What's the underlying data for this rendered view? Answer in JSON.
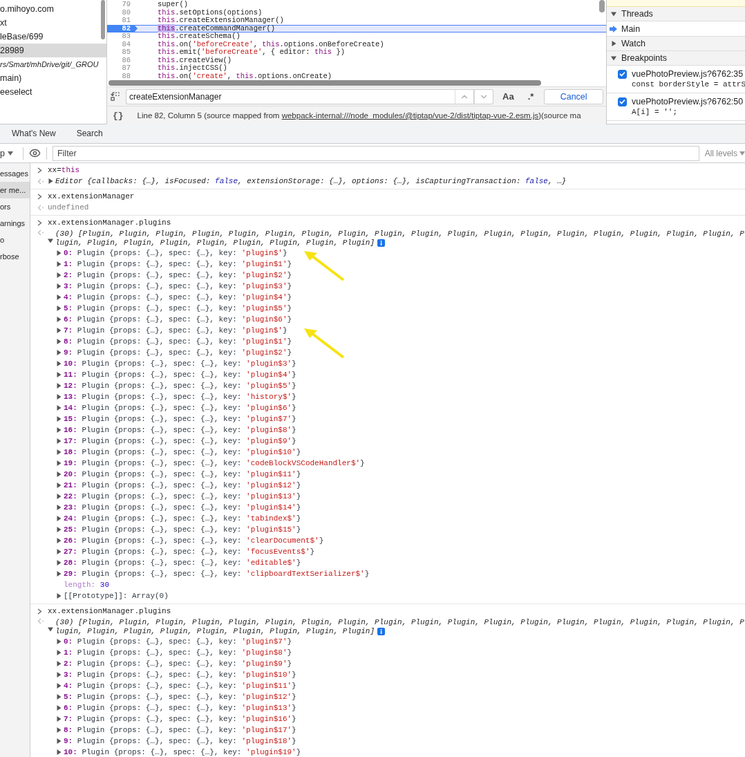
{
  "file_tree": {
    "items": [
      {
        "label": "o.mihoyo.com",
        "selected": false,
        "italic": false
      },
      {
        "label": "xt",
        "selected": false,
        "italic": false
      },
      {
        "label": "leBase/699",
        "selected": false,
        "italic": false
      },
      {
        "label": "28989",
        "selected": true,
        "italic": false
      },
      {
        "label": "rs/Smart/mhDrive/git/_GROU",
        "selected": false,
        "italic": true
      },
      {
        "label": "main)",
        "selected": false,
        "italic": false
      },
      {
        "label": "eeselect",
        "selected": false,
        "italic": false
      }
    ]
  },
  "editor": {
    "lines": [
      {
        "number": "79",
        "current": false,
        "tokens": [
          {
            "kind": "plain",
            "text": "super()"
          }
        ]
      },
      {
        "number": "80",
        "current": false,
        "tokens": [
          {
            "kind": "keyword",
            "text": "this"
          },
          {
            "kind": "plain",
            "text": ".setOptions(options)"
          }
        ]
      },
      {
        "number": "81",
        "current": false,
        "tokens": [
          {
            "kind": "keyword",
            "text": "this"
          },
          {
            "kind": "plain",
            "text": ".createExtensionManager()"
          }
        ]
      },
      {
        "number": "82",
        "current": true,
        "tokens": [
          {
            "kind": "match",
            "text": "this"
          },
          {
            "kind": "plain",
            "text": ".createCommandManager()"
          }
        ]
      },
      {
        "number": "83",
        "current": false,
        "tokens": [
          {
            "kind": "keyword",
            "text": "this"
          },
          {
            "kind": "plain",
            "text": ".createSchema()"
          }
        ]
      },
      {
        "number": "84",
        "current": false,
        "tokens": [
          {
            "kind": "keyword",
            "text": "this"
          },
          {
            "kind": "plain",
            "text": ".on("
          },
          {
            "kind": "string",
            "text": "'beforeCreate'"
          },
          {
            "kind": "plain",
            "text": ", "
          },
          {
            "kind": "keyword",
            "text": "this"
          },
          {
            "kind": "plain",
            "text": ".options.onBeforeCreate)"
          }
        ]
      },
      {
        "number": "85",
        "current": false,
        "tokens": [
          {
            "kind": "keyword",
            "text": "this"
          },
          {
            "kind": "plain",
            "text": ".emit("
          },
          {
            "kind": "string",
            "text": "'beforeCreate'"
          },
          {
            "kind": "plain",
            "text": ", { editor: "
          },
          {
            "kind": "keyword",
            "text": "this"
          },
          {
            "kind": "plain",
            "text": " })"
          }
        ]
      },
      {
        "number": "86",
        "current": false,
        "tokens": [
          {
            "kind": "keyword",
            "text": "this"
          },
          {
            "kind": "plain",
            "text": ".createView()"
          }
        ]
      },
      {
        "number": "87",
        "current": false,
        "tokens": [
          {
            "kind": "keyword",
            "text": "this"
          },
          {
            "kind": "plain",
            "text": ".injectCSS()"
          }
        ]
      },
      {
        "number": "88",
        "current": false,
        "tokens": [
          {
            "kind": "keyword",
            "text": "this"
          },
          {
            "kind": "plain",
            "text": ".on("
          },
          {
            "kind": "string",
            "text": "'create'"
          },
          {
            "kind": "plain",
            "text": ", "
          },
          {
            "kind": "keyword",
            "text": "this"
          },
          {
            "kind": "plain",
            "text": ".options.onCreate)"
          }
        ]
      }
    ],
    "search": {
      "value": "createExtensionManager",
      "match_case": "Aa",
      "regex": ".*",
      "cancel": "Cancel"
    },
    "status": {
      "pretty_print": "{}",
      "text": "Line 82, Column 5  (source mapped from ",
      "link": "webpack-internal:///node_modules/@tiptap/vue-2/dist/tiptap-vue-2.esm.js",
      "tail": ")(source ma"
    }
  },
  "debugger": {
    "sections": [
      {
        "kind": "threads",
        "title": "Threads",
        "expanded": true,
        "threads": [
          {
            "label": "Main",
            "current": true
          }
        ]
      },
      {
        "title": "Watch",
        "expanded": false
      },
      {
        "kind": "breakpoints",
        "title": "Breakpoints",
        "expanded": true,
        "breakpoints": [
          {
            "file": "vuePhotoPreview.js?6762:35",
            "code": "const borderStyle = attrS",
            "checked": true
          },
          {
            "file": "vuePhotoPreview.js?6762:50",
            "code": "A[i] = '';",
            "checked": true
          }
        ]
      }
    ]
  },
  "drawer_tabs": [
    {
      "label": "What's New",
      "selected": false
    },
    {
      "label": "Search",
      "selected": false
    }
  ],
  "console_toolbar": {
    "context": "p",
    "filter_placeholder": "Filter",
    "levels": "All levels"
  },
  "console_sidebar": [
    {
      "label": "essages",
      "selected": false
    },
    {
      "label": "er me...",
      "selected": true
    },
    {
      "label": "ors",
      "selected": false
    },
    {
      "label": "arnings",
      "selected": false
    },
    {
      "label": "o",
      "selected": false
    },
    {
      "label": "rbose",
      "selected": false
    }
  ],
  "messages": [
    {
      "input": [
        {
          "kind": "plain",
          "text": "xx="
        },
        {
          "kind": "keyword",
          "text": "this"
        }
      ],
      "output": {
        "kind": "object",
        "expanded": false,
        "tokens": [
          {
            "kind": "plain",
            "text": "Editor {callbacks: {…}, isFocused: "
          },
          {
            "kind": "bool",
            "text": "false"
          },
          {
            "kind": "plain",
            "text": ", extensionStorage: {…}, options: {…}, isCapturingTransaction: "
          },
          {
            "kind": "bool",
            "text": "false"
          },
          {
            "kind": "plain",
            "text": ", …}"
          }
        ]
      }
    },
    {
      "input": [
        {
          "kind": "plain",
          "text": "xx.extensionManager"
        }
      ],
      "output": {
        "kind": "undefined",
        "text": "undefined"
      }
    },
    {
      "input": [
        {
          "kind": "plain",
          "text": "xx.extensionManager.plugins"
        }
      ],
      "output": {
        "kind": "array",
        "expanded": true,
        "summary": [
          "(30) [Plugin, Plugin, Plugin, Plugin, Plugin, Plugin, Plugin, Plugin, Plugin, Plugin, Plugin, Plugin, Plugin, Plugin, Plugin, Plugin, Plugin, Plugin, P",
          "lugin, Plugin, Plugin, Plugin, Plugin, Plugin, Plugin, Plugin, Plugin]"
        ],
        "rows": [
          {
            "index": "0:",
            "preview": "Plugin {props: {…}, spec: {…}, key:",
            "key": "'plugin$'",
            "end": "}",
            "expanded": false,
            "arrow": true
          },
          {
            "index": "1:",
            "preview": "Plugin {props: {…}, spec: {…}, key:",
            "key": "'plugin$1'",
            "end": "}",
            "expanded": false,
            "arrow": false
          },
          {
            "index": "2:",
            "preview": "Plugin {props: {…}, spec: {…}, key:",
            "key": "'plugin$2'",
            "end": "}",
            "expanded": false,
            "arrow": false
          },
          {
            "index": "3:",
            "preview": "Plugin {props: {…}, spec: {…}, key:",
            "key": "'plugin$3'",
            "end": "}",
            "expanded": false,
            "arrow": false
          },
          {
            "index": "4:",
            "preview": "Plugin {props: {…}, spec: {…}, key:",
            "key": "'plugin$4'",
            "end": "}",
            "expanded": false,
            "arrow": false
          },
          {
            "index": "5:",
            "preview": "Plugin {props: {…}, spec: {…}, key:",
            "key": "'plugin$5'",
            "end": "}",
            "expanded": false,
            "arrow": false
          },
          {
            "index": "6:",
            "preview": "Plugin {props: {…}, spec: {…}, key:",
            "key": "'plugin$6'",
            "end": "}",
            "expanded": false,
            "arrow": false
          },
          {
            "index": "7:",
            "preview": "Plugin {props: {…}, spec: {…}, key:",
            "key": "'plugin$'",
            "end": "}",
            "expanded": false,
            "arrow": true
          },
          {
            "index": "8:",
            "preview": "Plugin {props: {…}, spec: {…}, key:",
            "key": "'plugin$1'",
            "end": "}",
            "expanded": false,
            "arrow": false
          },
          {
            "index": "9:",
            "preview": "Plugin {props: {…}, spec: {…}, key:",
            "key": "'plugin$2'",
            "end": "}",
            "expanded": false,
            "arrow": false
          },
          {
            "index": "10:",
            "preview": "Plugin {props: {…}, spec: {…}, key:",
            "key": "'plugin$3'",
            "end": "}",
            "expanded": false,
            "arrow": false
          },
          {
            "index": "11:",
            "preview": "Plugin {props: {…}, spec: {…}, key:",
            "key": "'plugin$4'",
            "end": "}",
            "expanded": false,
            "arrow": false
          },
          {
            "index": "12:",
            "preview": "Plugin {props: {…}, spec: {…}, key:",
            "key": "'plugin$5'",
            "end": "}",
            "expanded": false,
            "arrow": false
          },
          {
            "index": "13:",
            "preview": "Plugin {props: {…}, spec: {…}, key:",
            "key": "'history$'",
            "end": "}",
            "expanded": false,
            "arrow": false
          },
          {
            "index": "14:",
            "preview": "Plugin {props: {…}, spec: {…}, key:",
            "key": "'plugin$6'",
            "end": "}",
            "expanded": false,
            "arrow": false
          },
          {
            "index": "15:",
            "preview": "Plugin {props: {…}, spec: {…}, key:",
            "key": "'plugin$7'",
            "end": "}",
            "expanded": false,
            "arrow": false
          },
          {
            "index": "16:",
            "preview": "Plugin {props: {…}, spec: {…}, key:",
            "key": "'plugin$8'",
            "end": "}",
            "expanded": false,
            "arrow": false
          },
          {
            "index": "17:",
            "preview": "Plugin {props: {…}, spec: {…}, key:",
            "key": "'plugin$9'",
            "end": "}",
            "expanded": false,
            "arrow": false
          },
          {
            "index": "18:",
            "preview": "Plugin {props: {…}, spec: {…}, key:",
            "key": "'plugin$10'",
            "end": "}",
            "expanded": false,
            "arrow": false
          },
          {
            "index": "19:",
            "preview": "Plugin {props: {…}, spec: {…}, key:",
            "key": "'codeBlockVSCodeHandler$'",
            "end": "}",
            "expanded": false,
            "arrow": false
          },
          {
            "index": "20:",
            "preview": "Plugin {props: {…}, spec: {…}, key:",
            "key": "'plugin$11'",
            "end": "}",
            "expanded": false,
            "arrow": false
          },
          {
            "index": "21:",
            "preview": "Plugin {props: {…}, spec: {…}, key:",
            "key": "'plugin$12'",
            "end": "}",
            "expanded": false,
            "arrow": false
          },
          {
            "index": "22:",
            "preview": "Plugin {props: {…}, spec: {…}, key:",
            "key": "'plugin$13'",
            "end": "}",
            "expanded": false,
            "arrow": false
          },
          {
            "index": "23:",
            "preview": "Plugin {props: {…}, spec: {…}, key:",
            "key": "'plugin$14'",
            "end": "}",
            "expanded": false,
            "arrow": false
          },
          {
            "index": "24:",
            "preview": "Plugin {props: {…}, spec: {…}, key:",
            "key": "'tabindex$'",
            "end": "}",
            "expanded": false,
            "arrow": false
          },
          {
            "index": "25:",
            "preview": "Plugin {props: {…}, spec: {…}, key:",
            "key": "'plugin$15'",
            "end": "}",
            "expanded": false,
            "arrow": false
          },
          {
            "index": "26:",
            "preview": "Plugin {props: {…}, spec: {…}, key:",
            "key": "'clearDocument$'",
            "end": "}",
            "expanded": false,
            "arrow": false
          },
          {
            "index": "27:",
            "preview": "Plugin {props: {…}, spec: {…}, key:",
            "key": "'focusEvents$'",
            "end": "}",
            "expanded": false,
            "arrow": false
          },
          {
            "index": "28:",
            "preview": "Plugin {props: {…}, spec: {…}, key:",
            "key": "'editable$'",
            "end": "}",
            "expanded": false,
            "arrow": false
          },
          {
            "index": "29:",
            "preview": "Plugin {props: {…}, spec: {…}, key:",
            "key": "'clipboardTextSerializer$'",
            "end": "}",
            "expanded": false,
            "arrow": false
          }
        ],
        "length_label": "length:",
        "length": "30",
        "prototype": "[[Prototype]]: Array(0)",
        "prototype_expanded": false
      }
    },
    {
      "input": [
        {
          "kind": "plain",
          "text": "xx.extensionManager.plugins"
        }
      ],
      "output": {
        "kind": "array",
        "expanded": true,
        "summary": [
          "(30) [Plugin, Plugin, Plugin, Plugin, Plugin, Plugin, Plugin, Plugin, Plugin, Plugin, Plugin, Plugin, Plugin, Plugin, Plugin, Plugin, Plugin, Plugin, P",
          "lugin, Plugin, Plugin, Plugin, Plugin, Plugin, Plugin, Plugin, Plugin]"
        ],
        "rows": [
          {
            "index": "0:",
            "preview": "Plugin {props: {…}, spec: {…}, key:",
            "key": "'plugin$7'",
            "end": "}",
            "expanded": false,
            "arrow": false
          },
          {
            "index": "1:",
            "preview": "Plugin {props: {…}, spec: {…}, key:",
            "key": "'plugin$8'",
            "end": "}",
            "expanded": false,
            "arrow": false
          },
          {
            "index": "2:",
            "preview": "Plugin {props: {…}, spec: {…}, key:",
            "key": "'plugin$9'",
            "end": "}",
            "expanded": false,
            "arrow": false
          },
          {
            "index": "3:",
            "preview": "Plugin {props: {…}, spec: {…}, key:",
            "key": "'plugin$10'",
            "end": "}",
            "expanded": false,
            "arrow": false
          },
          {
            "index": "4:",
            "preview": "Plugin {props: {…}, spec: {…}, key:",
            "key": "'plugin$11'",
            "end": "}",
            "expanded": false,
            "arrow": false
          },
          {
            "index": "5:",
            "preview": "Plugin {props: {…}, spec: {…}, key:",
            "key": "'plugin$12'",
            "end": "}",
            "expanded": false,
            "arrow": false
          },
          {
            "index": "6:",
            "preview": "Plugin {props: {…}, spec: {…}, key:",
            "key": "'plugin$13'",
            "end": "}",
            "expanded": false,
            "arrow": false
          },
          {
            "index": "7:",
            "preview": "Plugin {props: {…}, spec: {…}, key:",
            "key": "'plugin$16'",
            "end": "}",
            "expanded": false,
            "arrow": false
          },
          {
            "index": "8:",
            "preview": "Plugin {props: {…}, spec: {…}, key:",
            "key": "'plugin$17'",
            "end": "}",
            "expanded": false,
            "arrow": false
          },
          {
            "index": "9:",
            "preview": "Plugin {props: {…}, spec: {…}, key:",
            "key": "'plugin$18'",
            "end": "}",
            "expanded": false,
            "arrow": false
          },
          {
            "index": "10:",
            "preview": "Plugin {props: {…}, spec: {…}, key:",
            "key": "'plugin$19'",
            "end": "}",
            "expanded": false,
            "arrow": false
          }
        ]
      }
    }
  ]
}
